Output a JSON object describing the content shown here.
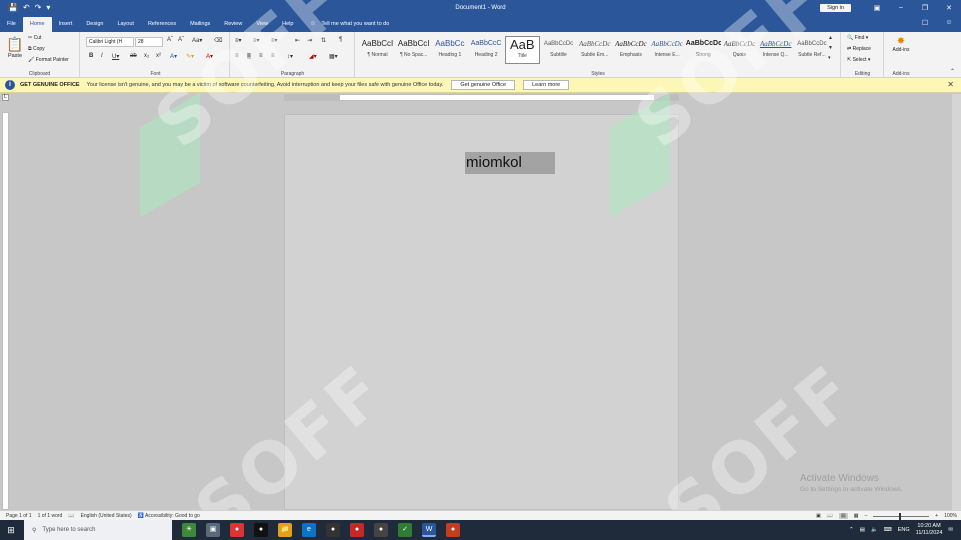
{
  "titlebar": {
    "title": "Document1  -  Word",
    "sign_in": "Sign in",
    "icons": [
      "save-icon",
      "undo-icon",
      "redo-icon",
      "customize-icon"
    ]
  },
  "tabs": [
    "File",
    "Home",
    "Insert",
    "Design",
    "Layout",
    "References",
    "Mailings",
    "Review",
    "View",
    "Help"
  ],
  "active_tab": "Home",
  "tell_me": "Tell me what you want to do",
  "ribbon": {
    "clipboard": {
      "paste": "Paste",
      "cut": "Cut",
      "copy": "Copy",
      "format_painter": "Format Painter",
      "label": "Clipboard"
    },
    "font": {
      "family": "Calibri Light (H",
      "size": "28",
      "label": "Font"
    },
    "paragraph": {
      "label": "Paragraph"
    },
    "styles": {
      "label": "Styles",
      "items": [
        {
          "preview": "AaBbCcI",
          "name": "¶ Normal"
        },
        {
          "preview": "AaBbCcI",
          "name": "¶ No Spac..."
        },
        {
          "preview": "AaBbCc",
          "name": "Heading 1"
        },
        {
          "preview": "AaBbCcC",
          "name": "Heading 2"
        },
        {
          "preview": "AaB",
          "name": "Title"
        },
        {
          "preview": "AaBbCcDc",
          "name": "Subtitle"
        },
        {
          "preview": "AaBbCcDc",
          "name": "Subtle Em..."
        },
        {
          "preview": "AaBbCcDc",
          "name": "Emphasis"
        },
        {
          "preview": "AaBbCcDc",
          "name": "Intense E..."
        },
        {
          "preview": "AaBbCcDc",
          "name": "Strong"
        },
        {
          "preview": "AaBbCcDc",
          "name": "Quote"
        },
        {
          "preview": "AaBbCcDc",
          "name": "Intense Q..."
        },
        {
          "preview": "AaBbCcDc",
          "name": "Subtle Ref..."
        }
      ],
      "selected": "Title"
    },
    "editing": {
      "find": "Find",
      "replace": "Replace",
      "select": "Select",
      "label": "Editing"
    },
    "addins": {
      "button": "Add-ins",
      "label": "Add-ins"
    }
  },
  "genuine_bar": {
    "title": "GET GENUINE OFFICE",
    "message": "Your license isn't genuine, and you may be a victim of software counterfeiting. Avoid interruption and keep your files safe with genuine Office today.",
    "button_primary": "Get genuine Office",
    "button_secondary": "Learn more"
  },
  "document": {
    "text": "miomkol"
  },
  "watermark": {
    "text": "SOFF"
  },
  "activate_windows": {
    "line1": "Activate Windows",
    "line2": "Go to Settings to activate Windows."
  },
  "status_bar": {
    "page": "Page 1 of 1",
    "words": "1 of 1 word",
    "language": "English (United States)",
    "accessibility": "Accessibility: Good to go",
    "zoom": "100%"
  },
  "taskbar": {
    "search_placeholder": "Type here to search",
    "lang": "ENG",
    "time": "10:20 AM",
    "date": "11/11/2024"
  }
}
